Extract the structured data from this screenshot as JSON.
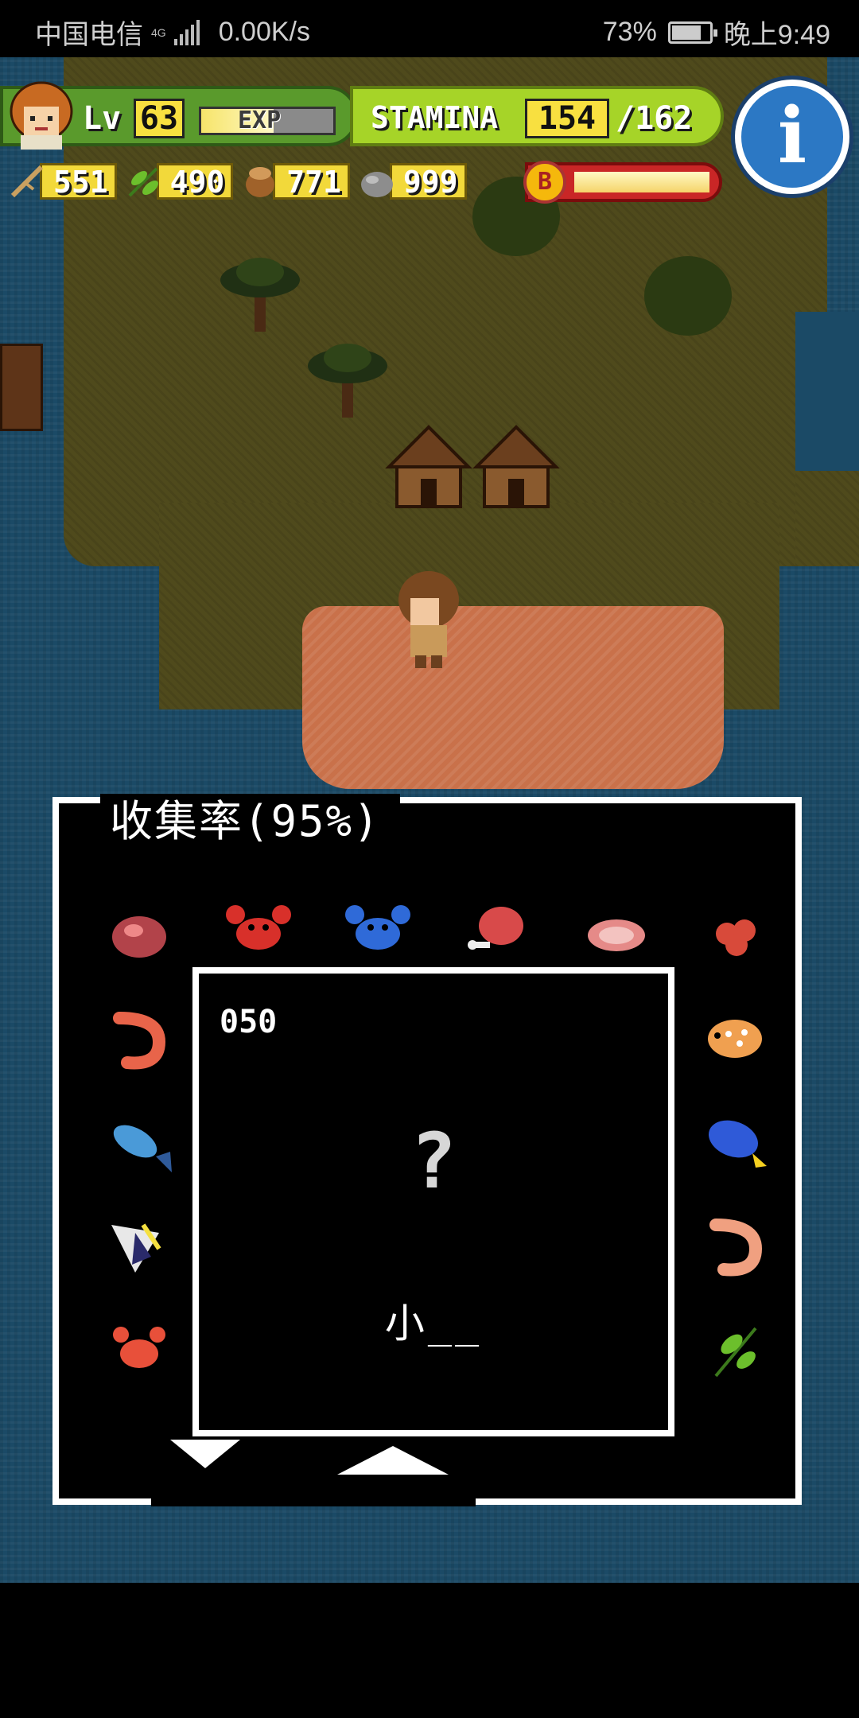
{
  "status_bar": {
    "carrier": "中国电信",
    "network": "4G",
    "speed": "0.00K/s",
    "battery_pct": "73%",
    "time": "晚上9:49"
  },
  "hud": {
    "level_label": "Lv",
    "level": "63",
    "exp_label": "EXP",
    "exp_fill_fraction": 0.55,
    "stamina_label": "STAMINA",
    "stamina": "154",
    "stamina_max": "/162",
    "resources": [
      {
        "icon": "branch-icon",
        "value": "551"
      },
      {
        "icon": "leaf-icon",
        "value": "490"
      },
      {
        "icon": "nut-icon",
        "value": "771"
      },
      {
        "icon": "stone-icon",
        "value": "999"
      }
    ],
    "boost_letter": "B",
    "info_icon": "info-icon"
  },
  "collection": {
    "title": "收集率(95%)",
    "items_top_row": [
      "meat-icon",
      "red-crab-icon",
      "blue-crab-icon",
      "ham-icon",
      "steak-icon",
      "crab-meat-icon"
    ],
    "items_left_col": [
      "shrimp-icon",
      "blue-fish-icon",
      "angelfish-icon",
      "lobster-icon"
    ],
    "items_right_col": [
      "spotted-fish-icon",
      "blue-tang-icon",
      "shrimp-icon",
      "herb-icon"
    ],
    "detail": {
      "id": "050",
      "mystery": "?",
      "name": "小__"
    }
  },
  "colors": {
    "ocean": "#1b4a66",
    "grass": "#4f4a1c",
    "sand": "#c9714a",
    "stamina_bar": "#a6d428",
    "level_bar": "#5a9a2c",
    "value_box": "#f8e040",
    "info_button": "#2c78c4"
  }
}
